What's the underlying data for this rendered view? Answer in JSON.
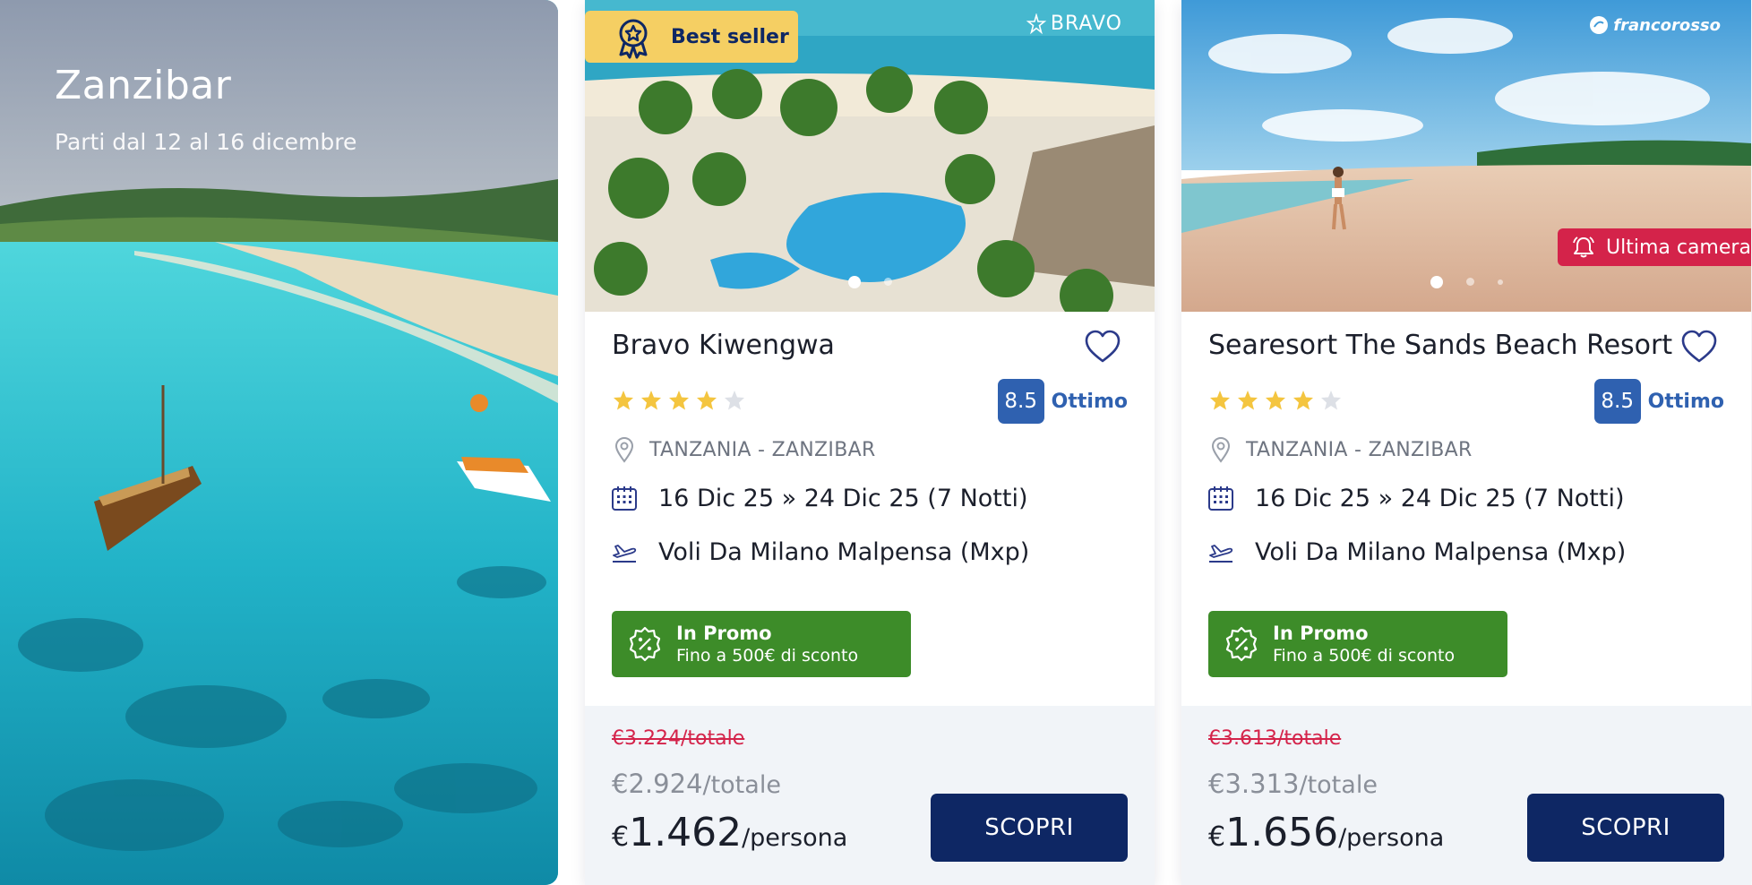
{
  "hero": {
    "title": "Zanzibar",
    "subtitle": "Parti dal 12 al 16 dicembre"
  },
  "cards": [
    {
      "badge": "Best seller",
      "brand": "BRAVO",
      "name": "Bravo Kiwengwa",
      "stars": 4,
      "stars_max": 5,
      "rating": "8.5",
      "rating_label": "Ottimo",
      "location": "TANZANIA - ZANZIBAR",
      "dates": "16 Dic 25 » 24 Dic 25 (7 Notti)",
      "flights": "Voli Da Milano Malpensa (Mxp)",
      "promo_title": "In Promo",
      "promo_sub": "Fino a 500€ di sconto",
      "price_old": "€3.224/totale",
      "price_mid": "€2.924",
      "price_mid_unit": "/totale",
      "price_currency": "€",
      "price_main": "1.462",
      "price_main_unit": "/persona",
      "cta": "SCOPRI",
      "carousel": {
        "slides": 2,
        "active": 1
      }
    },
    {
      "brand": "francorosso",
      "tag": "Ultima camera",
      "name": "Searesort The Sands Beach Resort",
      "stars": 4,
      "stars_max": 5,
      "rating": "8.5",
      "rating_label": "Ottimo",
      "location": "TANZANIA - ZANZIBAR",
      "dates": "16 Dic 25 » 24 Dic 25 (7 Notti)",
      "flights": "Voli Da Milano Malpensa (Mxp)",
      "promo_title": "In Promo",
      "promo_sub": "Fino a 500€ di sconto",
      "price_old": "€3.613/totale",
      "price_mid": "€3.313",
      "price_mid_unit": "/totale",
      "price_currency": "€",
      "price_main": "1.656",
      "price_main_unit": "/persona",
      "cta": "SCOPRI",
      "carousel": {
        "slides": 3,
        "active": 1
      }
    }
  ],
  "colors": {
    "primary": "#0e2764",
    "rating": "#2f61b0",
    "promo": "#3d8c29",
    "alert": "#d4234a",
    "badge": "#f5cf63",
    "star": "#f4c53f",
    "price_bg": "#f1f4f8"
  },
  "icons": [
    "award-icon",
    "bravo-logo-icon",
    "francorosso-logo-icon",
    "bell-icon",
    "heart-icon",
    "star-icon",
    "location-pin-icon",
    "calendar-icon",
    "plane-icon",
    "promo-percent-icon"
  ]
}
